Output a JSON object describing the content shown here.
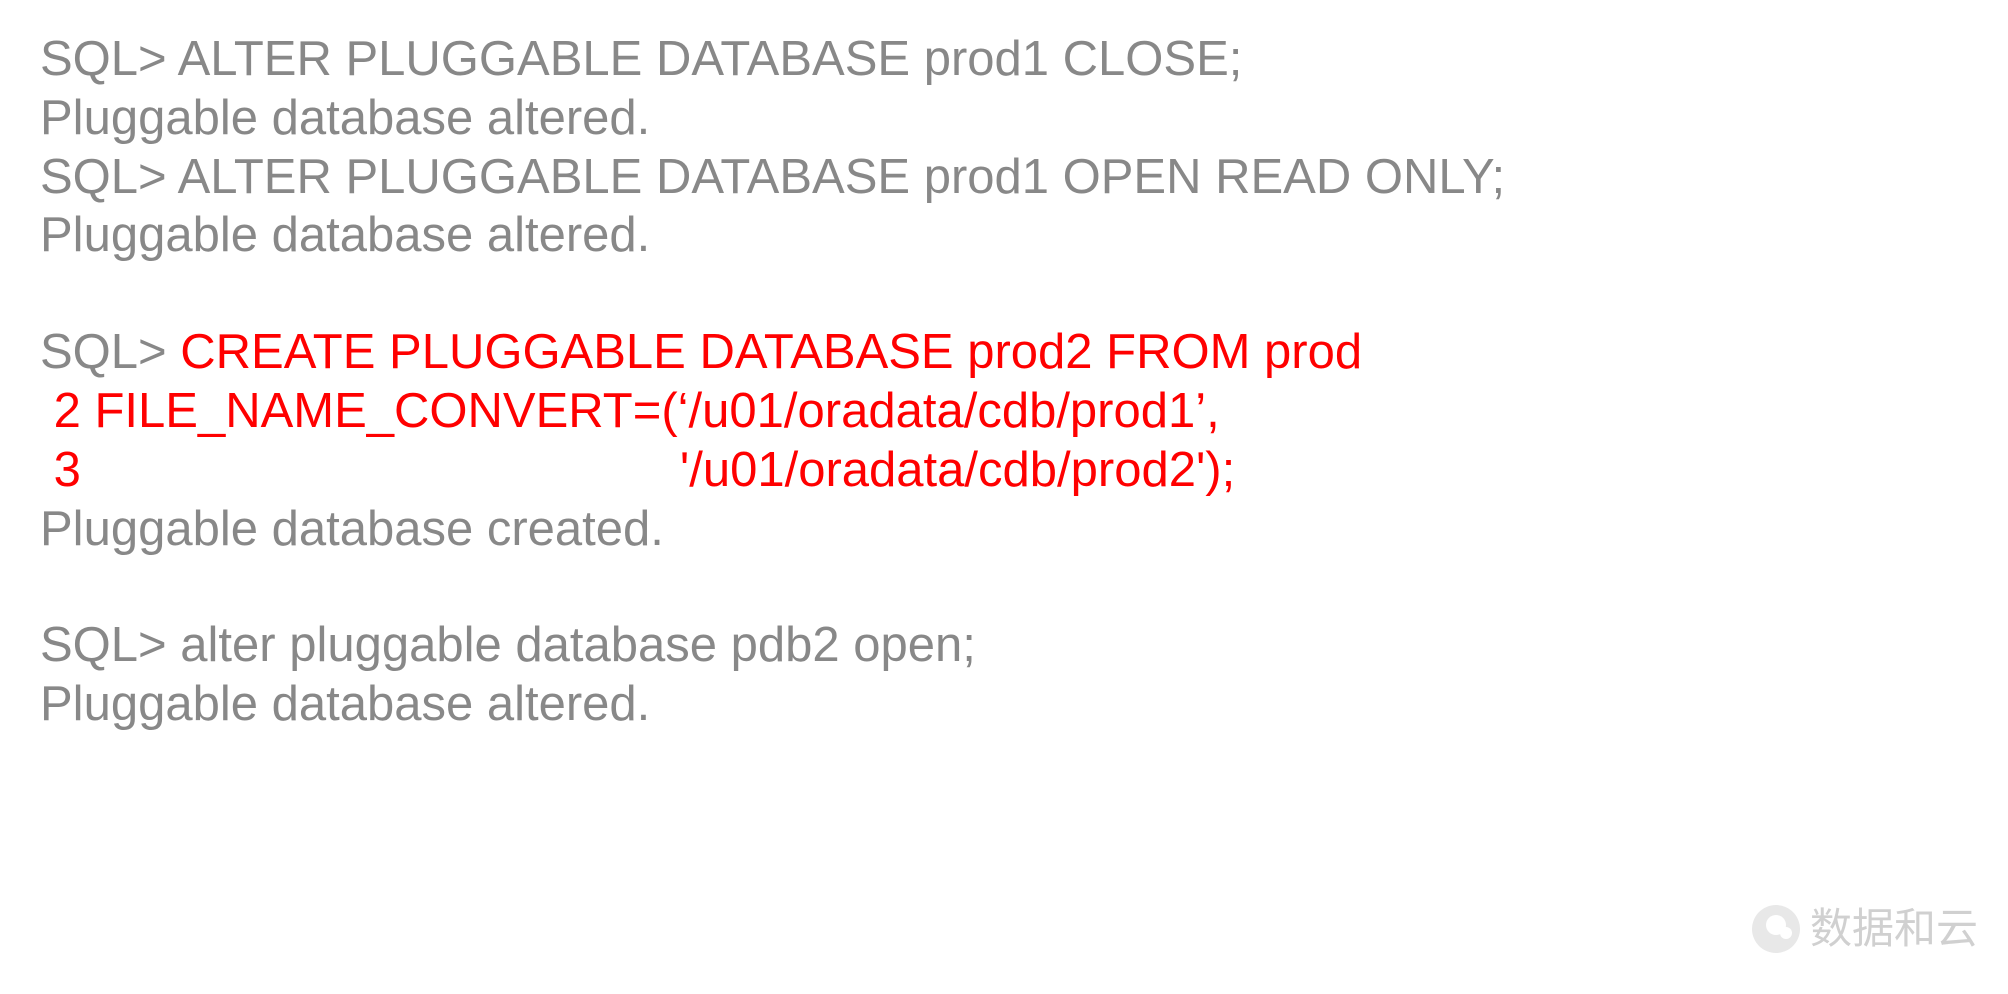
{
  "lines": {
    "l1": "SQL> ALTER PLUGGABLE DATABASE prod1 CLOSE;",
    "l2": "Pluggable database altered.",
    "l3": "SQL> ALTER PLUGGABLE DATABASE prod1 OPEN READ ONLY;",
    "l4": "Pluggable database altered.",
    "l5_prefix": "SQL> ",
    "l5_red": "CREATE PLUGGABLE DATABASE prod2 FROM prod",
    "l6": " 2 FILE_NAME_CONVERT=(‘/u01/oradata/cdb/prod1’,",
    "l7": " 3                                            '/u01/oradata/cdb/prod2');",
    "l8": "Pluggable database created.",
    "l9": "SQL> alter pluggable database pdb2 open;",
    "l10": "Pluggable database altered."
  },
  "watermark": {
    "text": "数据和云"
  }
}
